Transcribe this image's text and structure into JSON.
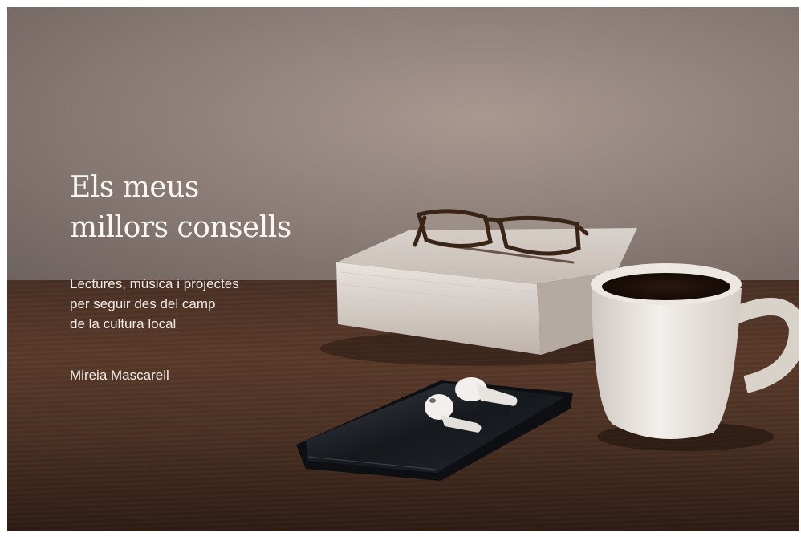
{
  "cover": {
    "title_line1": "Els meus",
    "title_line2": "millors consells",
    "subtitle_line1": "Lectures, música i projectes",
    "subtitle_line2": "per seguir des del camp",
    "subtitle_line3": "de la cultura local",
    "author": "Mireia Mascarell"
  }
}
